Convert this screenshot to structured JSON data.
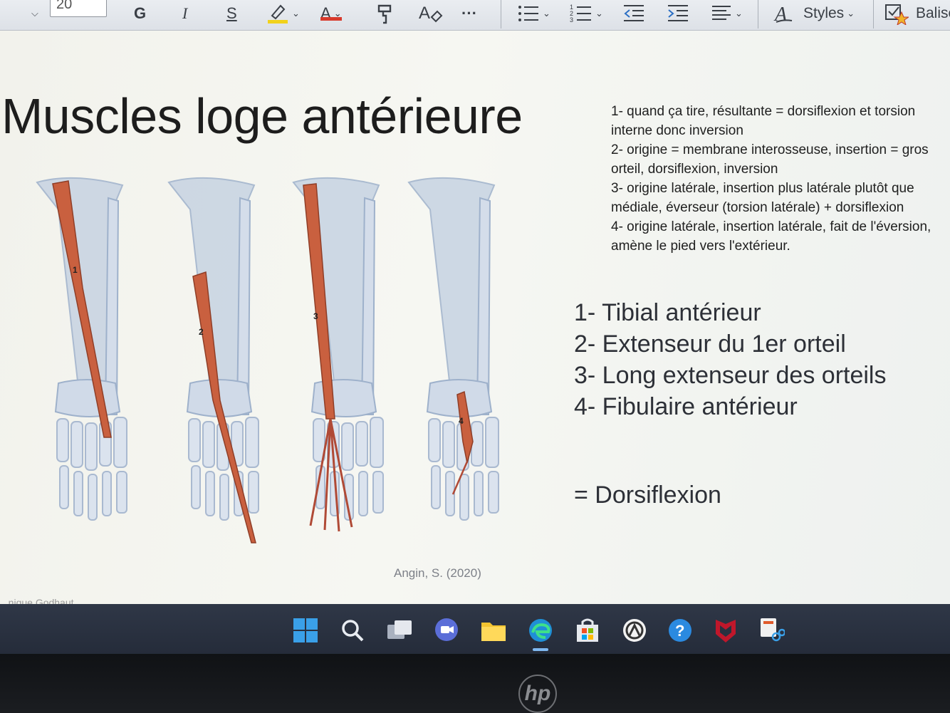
{
  "toolbar": {
    "font_size": "20",
    "bold": "G",
    "italic": "I",
    "underline": "S",
    "font_color": "A",
    "more": "···",
    "styles_label": "Styles",
    "tags_label": "Balise"
  },
  "slide": {
    "title": "Muscles loge antérieure",
    "notes": [
      "1- quand ça tire, résultante = dorsiflexion et torsion interne donc inversion",
      "2- origine = membrane interosseuse, insertion = gros orteil, dorsiflexion, inversion",
      "3- origine latérale, insertion plus latérale plutôt que médiale, éverseur (torsion latérale) + dorsiflexion",
      "4- origine latérale, insertion latérale, fait de l'éversion, amène le pied vers l'extérieur."
    ],
    "legend": [
      "1- Tibial antérieur",
      "2- Extenseur du 1er orteil",
      "3- Long extenseur des orteils",
      "4- Fibulaire antérieur"
    ],
    "summary": "= Dorsiflexion",
    "credit": "Angin, S. (2020)",
    "figure_numbers": [
      "1",
      "2",
      "3",
      "4"
    ],
    "author": "...nique Godhaut"
  },
  "colors": {
    "muscle": "#c9603f",
    "bone": "#c7d3e2",
    "taskbar": "#2a3140"
  },
  "taskbar_icons": [
    "start-icon",
    "search-icon",
    "task-view-icon",
    "chat-icon",
    "file-explorer-icon",
    "edge-icon",
    "store-icon",
    "app-icon",
    "help-icon",
    "mcafee-icon",
    "snipping-tool-icon"
  ],
  "bezel": {
    "brand": "hp"
  }
}
